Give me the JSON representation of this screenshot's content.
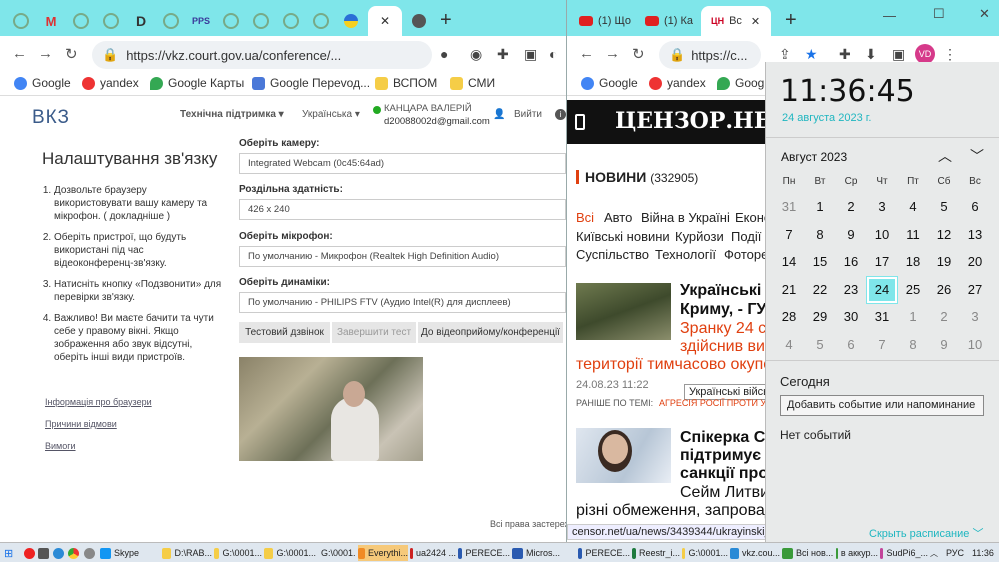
{
  "left_window": {
    "url": "https://vkz.court.gov.ua/conference/...",
    "bookmarks": [
      "Google",
      "yandex",
      "Google Карты",
      "Google Переvод...",
      "ВСПОМ",
      "СМИ"
    ],
    "site": {
      "logo": "ВКЗ",
      "nav_support": "Технічна підтримка",
      "nav_lang": "Українська",
      "user_name": "КАНЦАРА ВАЛЕРІЙ",
      "user_email": "d20088002d@gmail.com",
      "logout": "Вийти",
      "title": "Налаштування зв'язку",
      "steps": [
        "Дозвольте браузеру використовувати вашу камеру та мікрофон. ( докладніше )",
        "Оберіть пристрої, що будуть використані під час відеоконференц-зв'язку.",
        "Натисніть кнопку «Подзвонити» для перевірки зв'язку.",
        "Важливо! Ви маєте бачити та чути себе у правому вікні. Якщо зображення або звук відсутні, оберіть інші види пристроїв."
      ],
      "links": [
        "Інформація про браузери",
        "Причини відмови",
        "Вимоги"
      ],
      "camera_label": "Оберіть камеру:",
      "camera_value": "Integrated Webcam (0c45:64ad)",
      "resolution_label": "Роздільна здатність:",
      "resolution_value": "426 x 240",
      "mic_label": "Оберіть мікрофон:",
      "mic_value": "По умолчанию - Микрофон (Realtek High Definition Audio)",
      "speaker_label": "Оберіть динаміки:",
      "speaker_value": "По умолчанию - PHILIPS FTV (Аудио Intel(R) для дисплеев)",
      "btn_test": "Тестовий дзвінок",
      "btn_end": "Завершити тест",
      "btn_join": "До відеоприйому/конференції",
      "footer": "Всі права застереж"
    }
  },
  "right_window": {
    "tabs": [
      "(1) Що",
      "(1) Ка",
      "Вс"
    ],
    "url": "https://c...",
    "bookmarks": [
      "Google",
      "yandex",
      "Googl"
    ],
    "logo": "ЦЕНЗОР.НЕТ",
    "news_label": "НОВИНИ",
    "news_count": "(332905)",
    "categories": [
      [
        "Всі",
        "Авто",
        "Війна в Україні",
        "Еконо"
      ],
      [
        "Київські новини",
        "Курйози",
        "Події"
      ],
      [
        "Суспільство",
        "Технології",
        "Фоторе"
      ]
    ],
    "art1_title": [
      "Українські в",
      "Криму, - ГУР"
    ],
    "art1_sub": [
      "Зранку 24 се",
      "здійснив вис",
      "території тимчасово окупов"
    ],
    "art1_time": "24.08.23 11:22",
    "tooltip": "Українські війсь",
    "related": "РАНІШЕ ПО ТЕМІ:",
    "related_link": "АГРЕСІЯ РОСІЇ ПРОТИ УКРАЇ",
    "art2_title": [
      "Спікерка Се",
      "підтримує з",
      "санкції прот"
    ],
    "art2_sub": [
      "Сейм Литви",
      "різні обмеження, запровад"
    ],
    "status_url": "censor.net/ua/news/3439344/ukrayinski_v..."
  },
  "calendar": {
    "time": "11:36:45",
    "date": "24 августа 2023 г.",
    "month": "Август 2023",
    "weekdays": [
      "Пн",
      "Вт",
      "Ср",
      "Чт",
      "Пт",
      "Сб",
      "Вс"
    ],
    "days": [
      [
        "31",
        "1",
        "2",
        "3",
        "4",
        "5",
        "6"
      ],
      [
        "7",
        "8",
        "9",
        "10",
        "11",
        "12",
        "13"
      ],
      [
        "14",
        "15",
        "16",
        "17",
        "18",
        "19",
        "20"
      ],
      [
        "21",
        "22",
        "23",
        "24",
        "25",
        "26",
        "27"
      ],
      [
        "28",
        "29",
        "30",
        "31",
        "1",
        "2",
        "3"
      ],
      [
        "4",
        "5",
        "6",
        "7",
        "8",
        "9",
        "10"
      ]
    ],
    "today": "Сегодня",
    "add_event": "Добавить событие или напоминание",
    "no_events": "Нет событий",
    "hide": "Скрыть расписание"
  },
  "taskbar": {
    "items": [
      "Skype",
      "D:\\RAB...",
      "G:\\0001...",
      "G:\\0001...",
      "G:\\0001...",
      "Everythi...",
      "ua2424 ...",
      "PERECE...",
      "Micros...",
      "PERECE...",
      "Reestr_i...",
      "G:\\0001...",
      "vkz.cou...",
      "Всі нов...",
      "в аккур...",
      "SudPi6_..."
    ],
    "lang": "РУС",
    "clock": "11:36"
  }
}
